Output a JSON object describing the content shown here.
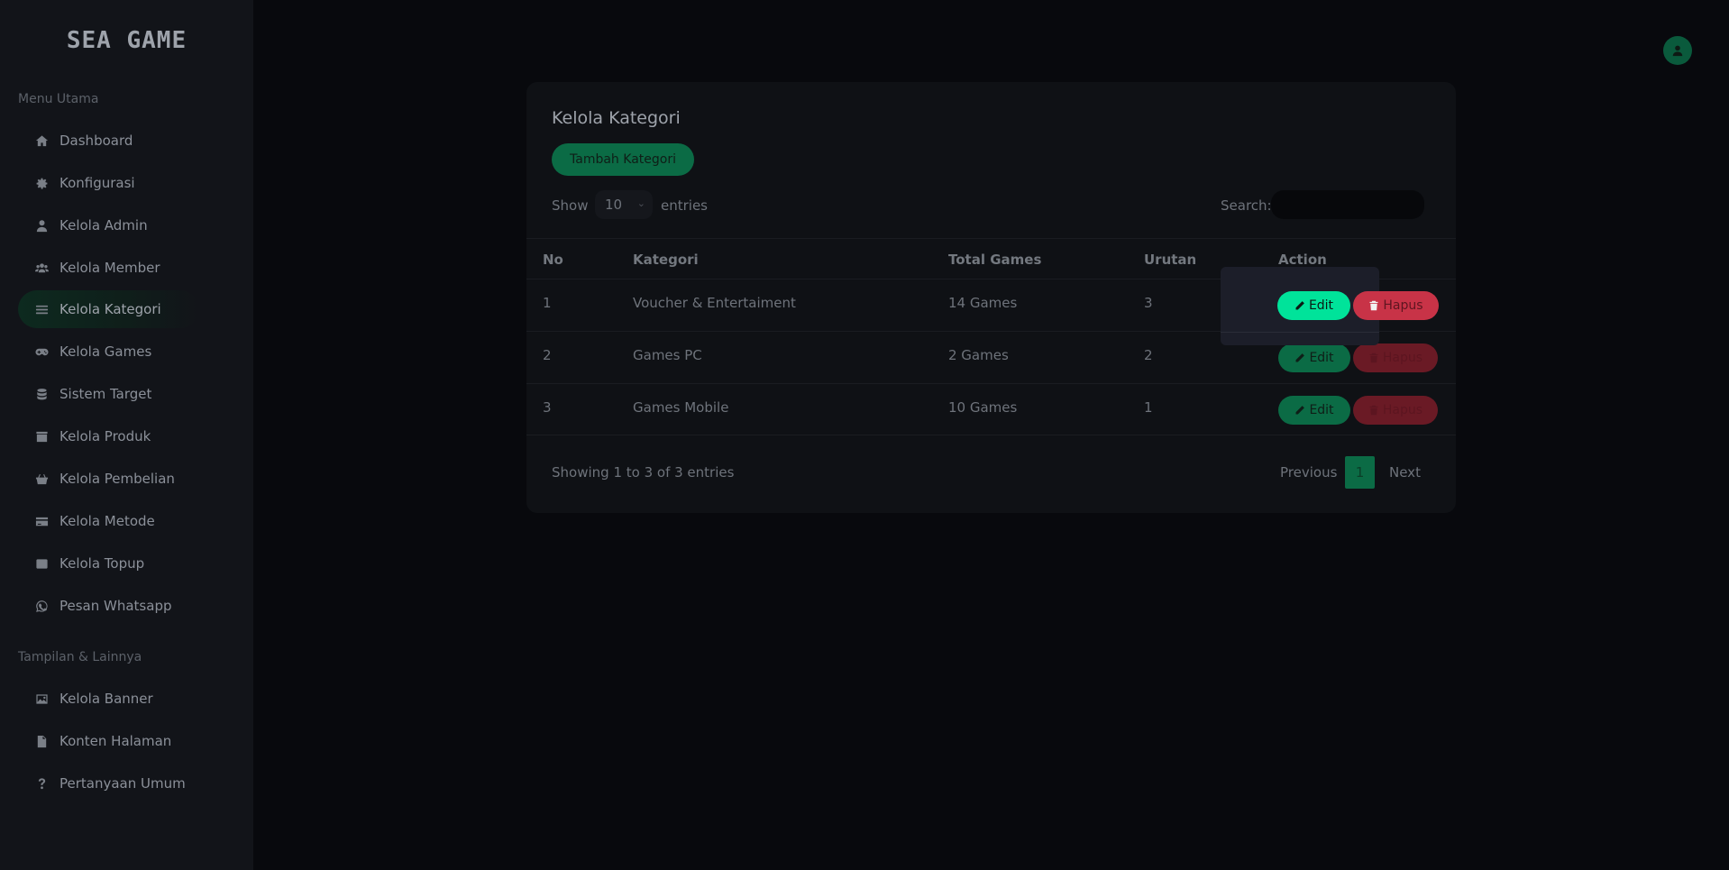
{
  "brand": {
    "logo_text": "SEA GAME"
  },
  "sidebar": {
    "section_main": "Menu Utama",
    "items": [
      {
        "label": "Dashboard",
        "icon": "home-icon"
      },
      {
        "label": "Konfigurasi",
        "icon": "gear-icon"
      },
      {
        "label": "Kelola Admin",
        "icon": "user-icon"
      },
      {
        "label": "Kelola Member",
        "icon": "users-icon"
      },
      {
        "label": "Kelola Kategori",
        "icon": "list-icon",
        "active": true
      },
      {
        "label": "Kelola Games",
        "icon": "gamepad-icon"
      },
      {
        "label": "Sistem Target",
        "icon": "database-icon"
      },
      {
        "label": "Kelola Produk",
        "icon": "box-icon"
      },
      {
        "label": "Kelola Pembelian",
        "icon": "basket-icon"
      },
      {
        "label": "Kelola Metode",
        "icon": "card-icon"
      },
      {
        "label": "Kelola Topup",
        "icon": "wallet-icon"
      },
      {
        "label": "Pesan Whatsapp",
        "icon": "whatsapp-icon"
      }
    ],
    "section_other": "Tampilan & Lainnya",
    "other_items": [
      {
        "label": "Kelola Banner",
        "icon": "image-icon"
      },
      {
        "label": "Konten Halaman",
        "icon": "file-icon"
      },
      {
        "label": "Pertanyaan Umum",
        "icon": "question-icon"
      }
    ]
  },
  "header": {
    "avatar_icon": "user-avatar-icon"
  },
  "main": {
    "title": "Kelola Kategori",
    "add_button": "Tambah Kategori",
    "show_label": "Show",
    "entries_value": "10",
    "entries_label": "entries",
    "search_label": "Search:",
    "search_value": "",
    "columns": [
      "No",
      "Kategori",
      "Total Games",
      "Urutan",
      "Action"
    ],
    "rows": [
      {
        "no": "1",
        "kategori": "Voucher & Entertaiment",
        "total": "14 Games",
        "urutan": "3"
      },
      {
        "no": "2",
        "kategori": "Games PC",
        "total": "2 Games",
        "urutan": "2"
      },
      {
        "no": "3",
        "kategori": "Games Mobile",
        "total": "10 Games",
        "urutan": "1"
      }
    ],
    "edit_label": "Edit",
    "delete_label": "Hapus",
    "info": "Showing 1 to 3 of 3 entries",
    "pagination": {
      "previous": "Previous",
      "current": "1",
      "next": "Next"
    }
  },
  "colors": {
    "accent": "#00e39a",
    "danger": "#c83347",
    "background": "#08090d",
    "sidebar": "#121419"
  }
}
